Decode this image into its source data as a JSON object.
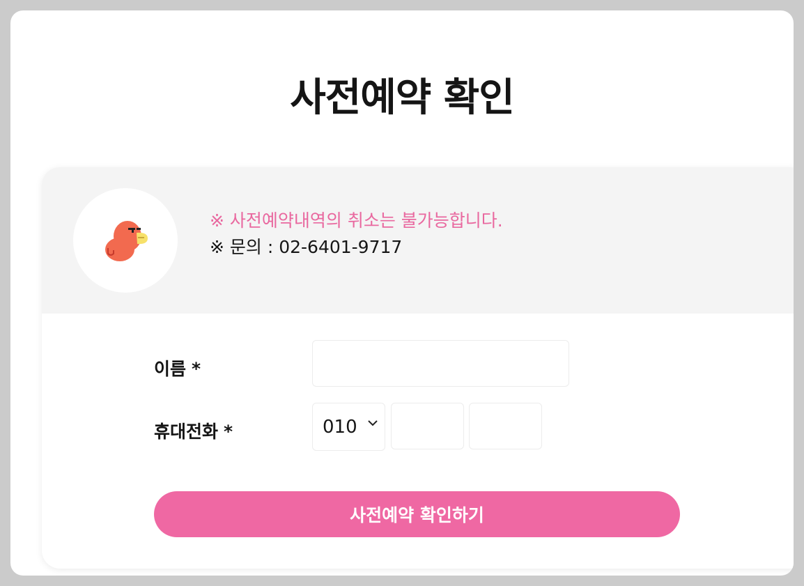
{
  "page": {
    "title": "사전예약 확인"
  },
  "notice": {
    "warning": "※ 사전예약내역의 취소는 불가능합니다.",
    "contact": "※ 문의 : 02-6401-9717",
    "warning_color": "#e9689f"
  },
  "avatar": {
    "icon": "bird-mascot-icon"
  },
  "form": {
    "name": {
      "label": "이름",
      "required_mark": "*",
      "value": ""
    },
    "phone": {
      "label": "휴대전화",
      "required_mark": "*",
      "prefix_selected": "010",
      "middle_value": "",
      "last_value": ""
    },
    "submit_label": "사전예약 확인하기",
    "accent_color": "#ef68a3"
  }
}
